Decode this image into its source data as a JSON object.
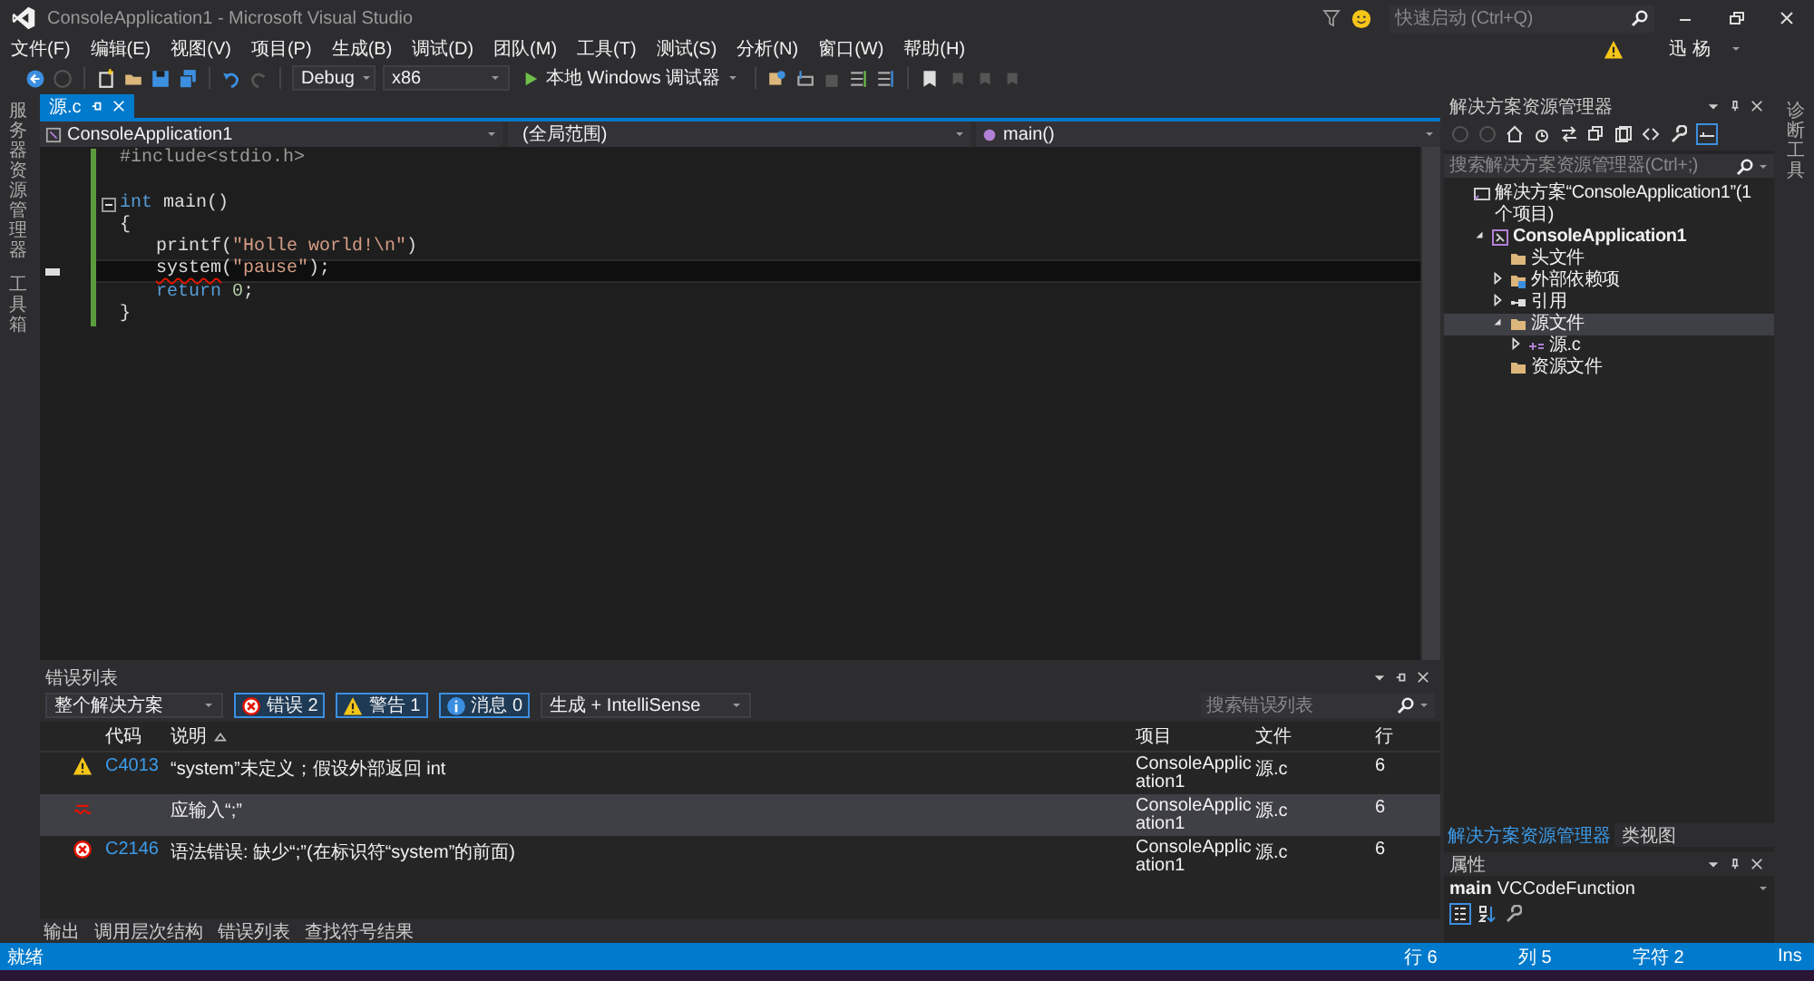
{
  "title_bar": {
    "title": "ConsoleApplication1 - Microsoft Visual Studio",
    "quick_launch": {
      "placeholder": "快速启动 (Ctrl+Q)"
    }
  },
  "menu": [
    "文件(F)",
    "编辑(E)",
    "视图(V)",
    "项目(P)",
    "生成(B)",
    "调试(D)",
    "团队(M)",
    "工具(T)",
    "测试(S)",
    "分析(N)",
    "窗口(W)",
    "帮助(H)"
  ],
  "user": {
    "name": "迅 杨"
  },
  "toolbar": {
    "configuration": "Debug",
    "platform": "x86",
    "debugger": "本地 Windows 调试器"
  },
  "left_tabs": [
    "服务器资源管理器",
    "工具箱"
  ],
  "right_tabs": [
    "诊断工具"
  ],
  "editor": {
    "tabs": [
      {
        "label": "源.c",
        "selected": true
      }
    ],
    "navigation": {
      "project": "ConsoleApplication1",
      "scope": "(全局范围)",
      "member": "main()"
    },
    "lines": [
      {
        "kind": "code",
        "indented": false,
        "current": false,
        "tokens": [
          {
            "kind": "preproc",
            "text": "#include<stdio.h>",
            "error": false
          }
        ]
      },
      {
        "kind": "blank",
        "current": false
      },
      {
        "kind": "fold-start",
        "indented": false,
        "current": false,
        "tokens": [
          {
            "kind": "keyword",
            "text": "int",
            "error": false
          },
          {
            "kind": "plain",
            "text": " main()",
            "error": false
          }
        ]
      },
      {
        "kind": "code",
        "indented": false,
        "current": false,
        "tokens": [
          {
            "kind": "plain",
            "text": "{",
            "error": false
          }
        ]
      },
      {
        "kind": "code",
        "indented": true,
        "current": false,
        "tokens": [
          {
            "kind": "plain",
            "text": "printf(",
            "error": false
          },
          {
            "kind": "string",
            "text": "\"Holle world!\\n\"",
            "error": false
          },
          {
            "kind": "plain",
            "text": ")",
            "error": false
          }
        ]
      },
      {
        "kind": "code",
        "indented": true,
        "current": true,
        "tokens": [
          {
            "kind": "plain",
            "text": "system",
            "error": true
          },
          {
            "kind": "plain",
            "text": "(",
            "error": false
          },
          {
            "kind": "string",
            "text": "\"pause\"",
            "error": false
          },
          {
            "kind": "plain",
            "text": ");",
            "error": false
          }
        ]
      },
      {
        "kind": "code",
        "indented": true,
        "current": false,
        "tokens": [
          {
            "kind": "keyword",
            "text": "return",
            "error": false
          },
          {
            "kind": "number",
            "text": " 0",
            "error": false
          },
          {
            "kind": "plain",
            "text": ";",
            "error": false
          }
        ]
      },
      {
        "kind": "code",
        "indented": false,
        "current": false,
        "tokens": [
          {
            "kind": "plain",
            "text": "}",
            "error": false
          }
        ]
      }
    ]
  },
  "error_list": {
    "title": "错误列表",
    "scope": "整个解决方案",
    "filters": [
      {
        "kind": "error",
        "label": "错误 2",
        "selected": true
      },
      {
        "kind": "warning",
        "label": "警告 1",
        "selected": true
      },
      {
        "kind": "info",
        "label": "消息 0",
        "selected": true
      }
    ],
    "source": "生成 + IntelliSense",
    "search": {
      "placeholder": "搜索错误列表"
    },
    "columns": {
      "code": "代码",
      "description": "说明",
      "project": "项目",
      "file": "文件",
      "line": "行"
    },
    "rows": [
      {
        "kind": "warning",
        "code": "C4013",
        "description": "“system”未定义；假设外部返回 int",
        "project": "ConsoleApplication1",
        "file": "源.c",
        "line": "6",
        "selected": false
      },
      {
        "kind": "intellisense",
        "description": "应输入“;”",
        "project": "ConsoleApplication1",
        "file": "源.c",
        "line": "6",
        "selected": true
      },
      {
        "kind": "error",
        "code": "C2146",
        "description": "语法错误: 缺少“;”(在标识符“system”的前面)",
        "project": "ConsoleApplication1",
        "file": "源.c",
        "line": "6",
        "selected": false
      }
    ]
  },
  "bottom_tabs": [
    "输出",
    "调用层次结构",
    "错误列表",
    "查找符号结果"
  ],
  "solution_explorer": {
    "title": "解决方案资源管理器",
    "search": {
      "placeholder": "搜索解决方案资源管理器(Ctrl+;)"
    },
    "tree": [
      {
        "kind": "solution",
        "label": "解决方案“ConsoleApplication1”(1 个项目)",
        "selected": false,
        "children": [
          {
            "kind": "project",
            "label": "ConsoleApplication1",
            "selected": false,
            "expanded": true,
            "children": [
              {
                "kind": "folder",
                "label": "头文件",
                "selected": false
              },
              {
                "kind": "external",
                "label": "外部依赖项",
                "selected": false,
                "expanded": false
              },
              {
                "kind": "references",
                "label": "引用",
                "selected": false,
                "expanded": false
              },
              {
                "kind": "folder",
                "label": "源文件",
                "selected": true,
                "expanded": true,
                "children": [
                  {
                    "kind": "file",
                    "label": "源.c",
                    "selected": false,
                    "expanded": false
                  }
                ]
              },
              {
                "kind": "folder",
                "label": "资源文件",
                "selected": false
              }
            ]
          }
        ]
      }
    ],
    "tabs": [
      {
        "label": "解决方案资源管理器",
        "selected": true
      },
      {
        "label": "类视图",
        "selected": false
      }
    ]
  },
  "properties": {
    "title": "属性",
    "object": "main",
    "type": "VCCodeFunction"
  },
  "status_bar": {
    "message": "就绪",
    "line": "行 6",
    "column": "列 5",
    "character": "字符 2",
    "mode": "Ins"
  }
}
